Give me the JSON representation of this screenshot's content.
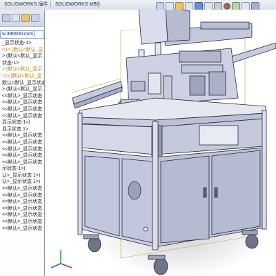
{
  "command_manager": {
    "tabs": [
      {
        "label": "SOLIDWORKS 插件"
      },
      {
        "label": "SOLIDWORKS MBD"
      }
    ]
  },
  "feature_manager": {
    "filter_text": "w.386600.com]",
    "tree_rows": [
      {
        "label": "_显示状态-1>",
        "style": "plain"
      },
      {
        "label": "<1> (默认<默认_显",
        "style": "hl"
      },
      {
        "label": "> (默认<默认_显示",
        "style": "plain"
      },
      {
        "label": "状态-1>",
        "style": "plain"
      },
      {
        "label": "> (默认<默认_显示",
        "style": "hl"
      },
      {
        "label": "-1> (默认<默认_显",
        "style": "hl"
      },
      {
        "label": "默认<默认_显示状态",
        "style": "plain"
      },
      {
        "label": "> (默认<默认_显示",
        "style": "plain"
      },
      {
        "label": "<<默认>_显示状态",
        "style": "plain"
      },
      {
        "label": "<<默认>_显示状态",
        "style": "plain"
      },
      {
        "label": "<<默认>_显示状态",
        "style": "plain"
      },
      {
        "label": "<<默认>_显示状态",
        "style": "plain"
      },
      {
        "label": "显示状态-1>)",
        "style": "plain"
      },
      {
        "label": "显示状态 1>",
        "style": "plain"
      },
      {
        "label": "<<默认>_显示状态",
        "style": "plain"
      },
      {
        "label": "<<默认>_显示状态",
        "style": "plain"
      },
      {
        "label": "<<默认>_显示状态",
        "style": "plain"
      },
      {
        "label": "<<默认>_显示状态",
        "style": "plain"
      },
      {
        "label": "<<默认>_显示状态",
        "style": "plain"
      },
      {
        "label": "示状态-1>)",
        "style": "plain"
      },
      {
        "label": "认>_显示状态 1>)",
        "style": "plain"
      },
      {
        "label": "认>_显示状态 1>)",
        "style": "plain"
      },
      {
        "label": "<<默认>_显示状态",
        "style": "plain"
      },
      {
        "label": "<<默认>_显示状态",
        "style": "plain"
      },
      {
        "label": "<<默认>_显示状态",
        "style": "plain"
      },
      {
        "label": "<<默认>_显示状态",
        "style": "plain"
      },
      {
        "label": "<<默认>_显示状态",
        "style": "plain"
      },
      {
        "label": "<<默认>_显示状态",
        "style": "plain"
      },
      {
        "label": "<<默认>_显示状态",
        "style": "plain"
      }
    ]
  },
  "graphics": {
    "model": "automation-machine-assembly",
    "colors": {
      "frame": "#d8dce8",
      "panel": "#c9cde3",
      "edge": "#2a2a3a",
      "background": "#ffffff"
    }
  }
}
